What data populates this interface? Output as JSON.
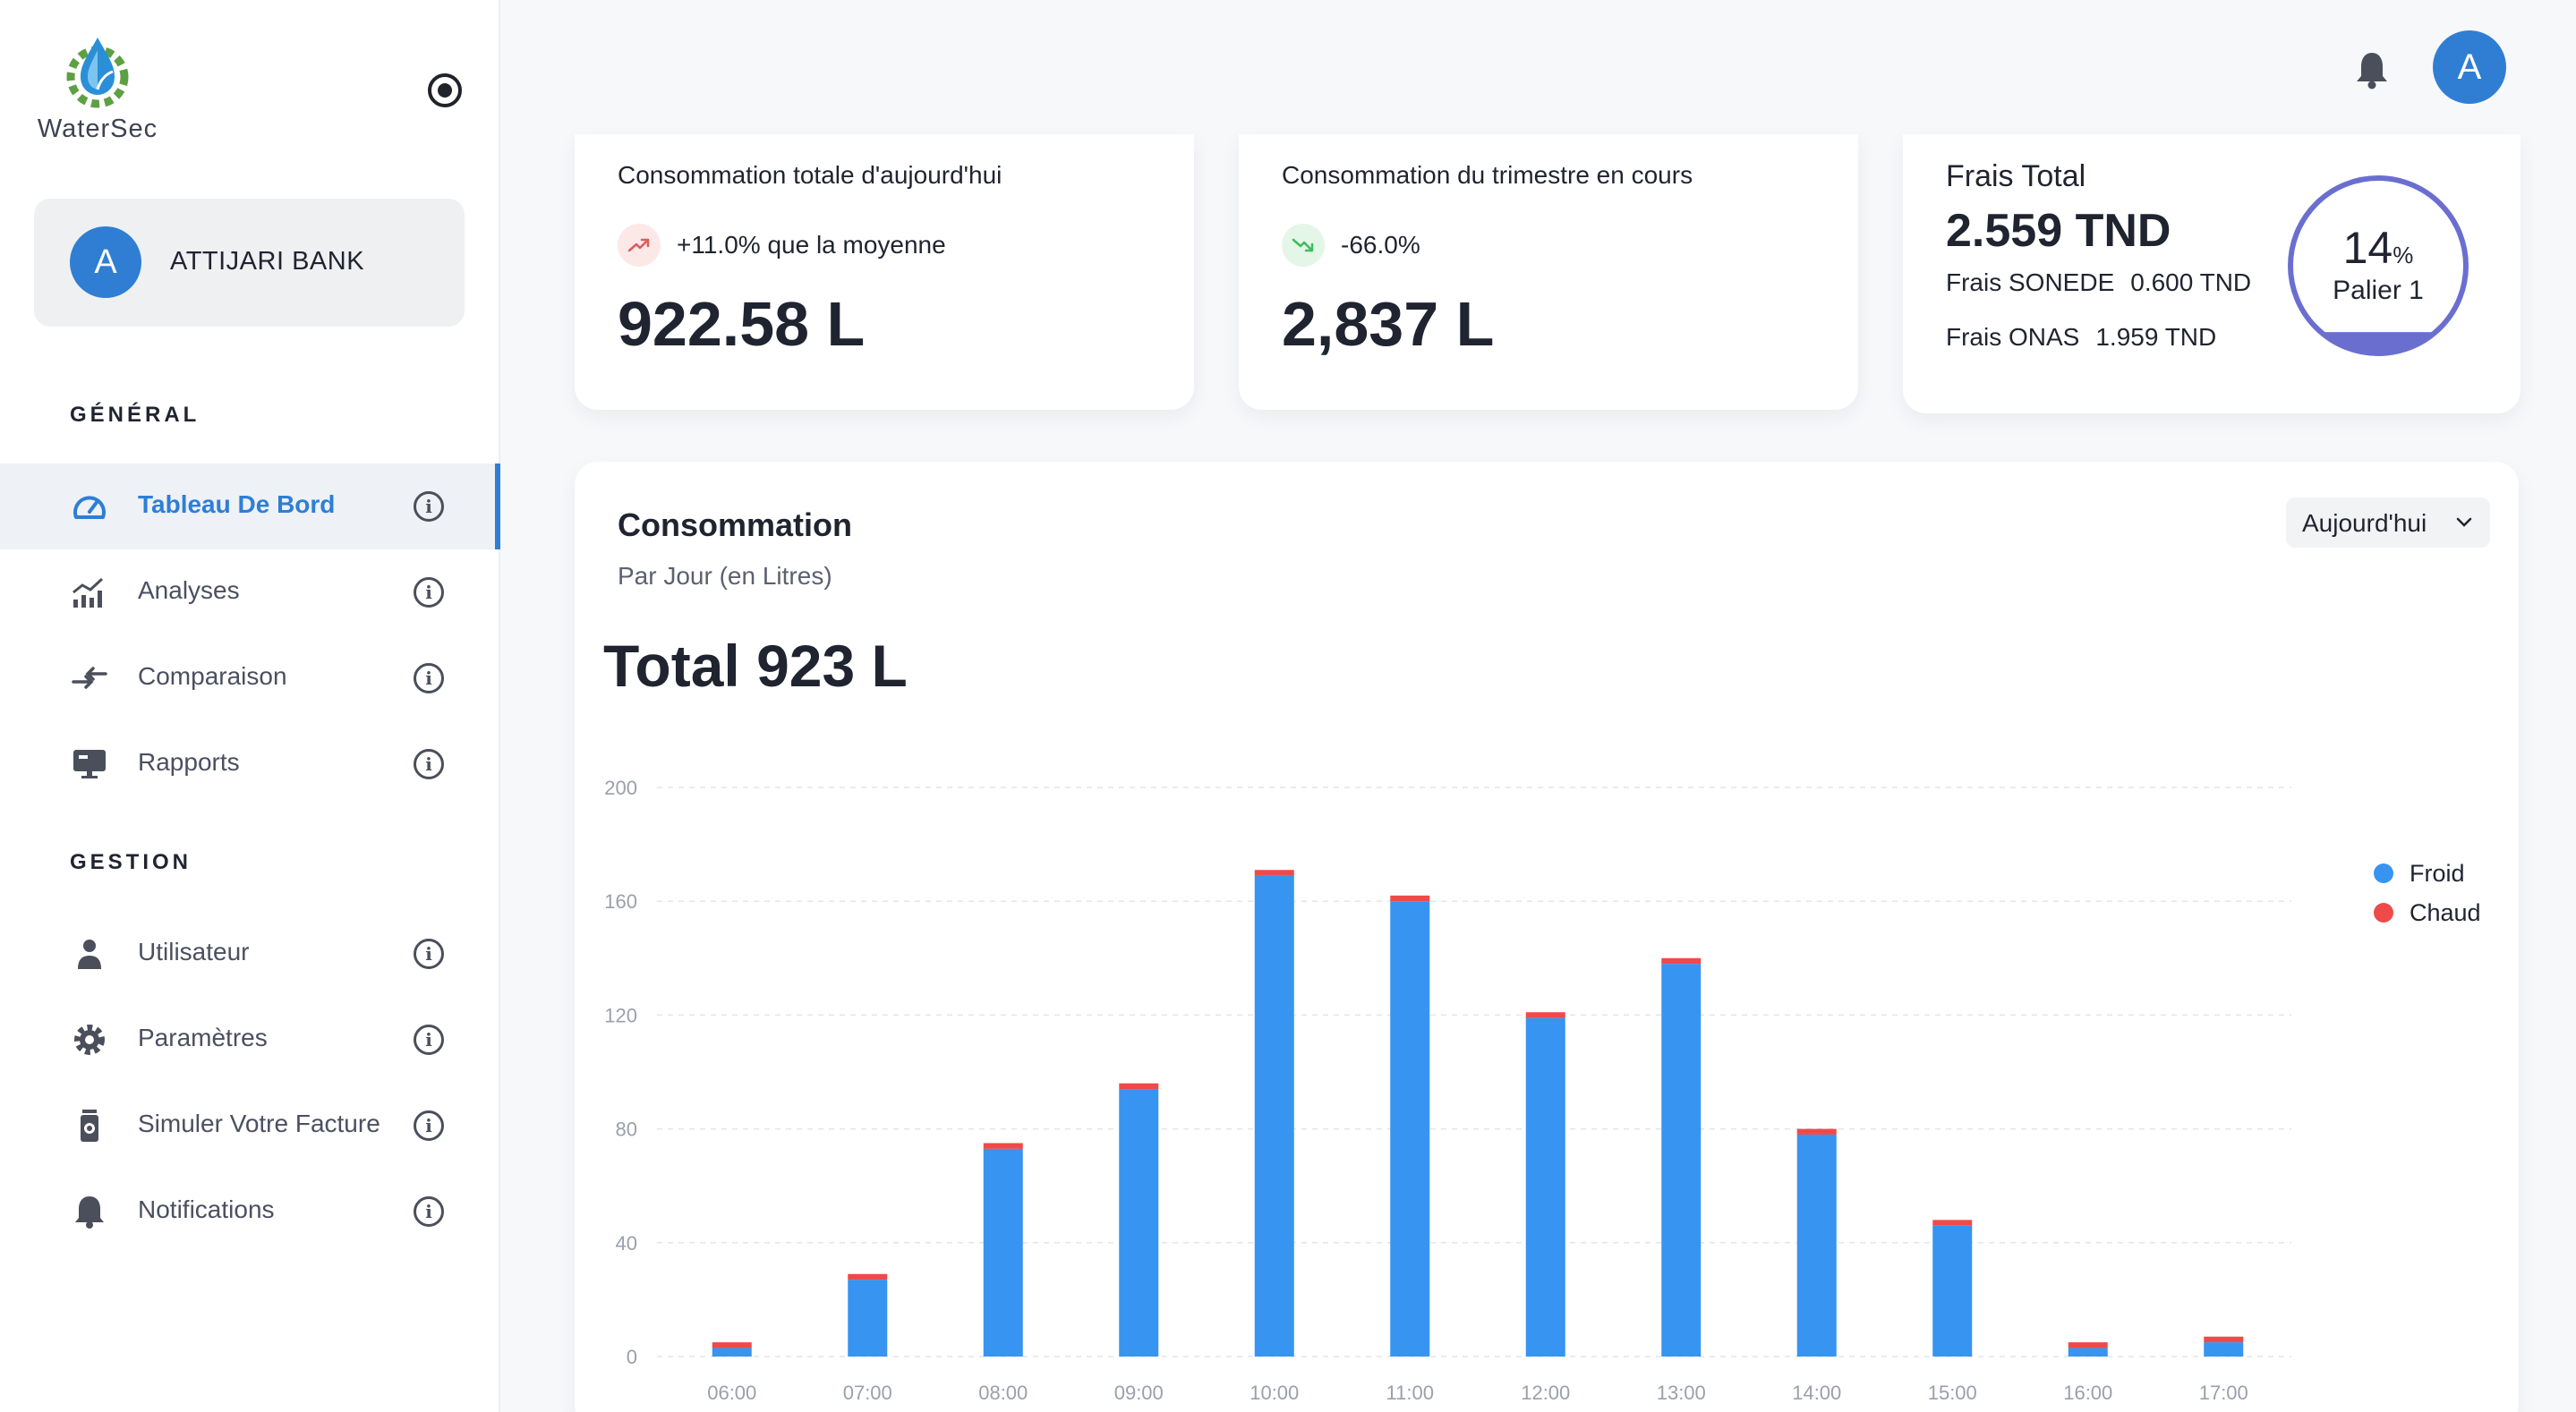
{
  "brand": {
    "name": "WaterSec"
  },
  "account": {
    "initial": "A",
    "name": "ATTIJARI BANK"
  },
  "sidebar": {
    "sections": [
      {
        "title": "GÉNÉRAL",
        "items": [
          {
            "label": "Tableau De Bord",
            "icon": "dashboard-icon",
            "active": true
          },
          {
            "label": "Analyses",
            "icon": "analytics-icon"
          },
          {
            "label": "Comparaison",
            "icon": "compare-icon"
          },
          {
            "label": "Rapports",
            "icon": "reports-icon"
          }
        ]
      },
      {
        "title": "GESTION",
        "items": [
          {
            "label": "Utilisateur",
            "icon": "user-icon"
          },
          {
            "label": "Paramètres",
            "icon": "gear-icon"
          },
          {
            "label": "Simuler Votre Facture",
            "icon": "bill-simulator-icon"
          },
          {
            "label": "Notifications",
            "icon": "bell-icon"
          }
        ]
      }
    ]
  },
  "topbar": {
    "avatar_initial": "A",
    "notification_icon": "bell-icon"
  },
  "cards": {
    "today": {
      "title": "Consommation totale d'aujourd'hui",
      "trend": "+11.0% que la moyenne",
      "trend_icon": "trend-up-icon",
      "trend_color": "#e05a5a",
      "value": "922.58 L"
    },
    "quarter": {
      "title": "Consommation du trimestre en cours",
      "trend": "-66.0%",
      "trend_icon": "trend-down-icon",
      "trend_color": "#3bbd5b",
      "value": "2,837 L"
    },
    "fees": {
      "title": "Frais Total",
      "total": "2.559 TND",
      "sonede_label": "Frais SONEDE",
      "sonede_value": "0.600 TND",
      "onas_label": "Frais ONAS",
      "onas_value": "1.959 TND",
      "gauge_percent": "14",
      "gauge_unit": "%",
      "gauge_fraction": 0.14,
      "gauge_level": "Palier 1",
      "gauge_color": "#6a6fcf"
    }
  },
  "consumption": {
    "title": "Consommation",
    "subtitle": "Par Jour (en Litres)",
    "total": "Total 923 L",
    "period": "Aujourd'hui"
  },
  "chart_data": {
    "type": "bar",
    "stacked": true,
    "categories": [
      "06:00",
      "07:00",
      "08:00",
      "09:00",
      "10:00",
      "11:00",
      "12:00",
      "13:00",
      "14:00",
      "15:00",
      "16:00",
      "17:00"
    ],
    "series": [
      {
        "name": "Froid",
        "color": "#3794f0",
        "values": [
          3,
          27,
          73,
          94,
          169,
          160,
          119,
          138,
          78,
          46,
          3,
          5
        ]
      },
      {
        "name": "Chaud",
        "color": "#ef4a4a",
        "values": [
          2,
          2,
          2,
          2,
          2,
          2,
          2,
          2,
          2,
          2,
          2,
          2
        ]
      }
    ],
    "yticks": [
      0,
      40,
      80,
      120,
      160,
      200
    ],
    "ylim": [
      0,
      200
    ],
    "grid": true,
    "legend": "right"
  }
}
